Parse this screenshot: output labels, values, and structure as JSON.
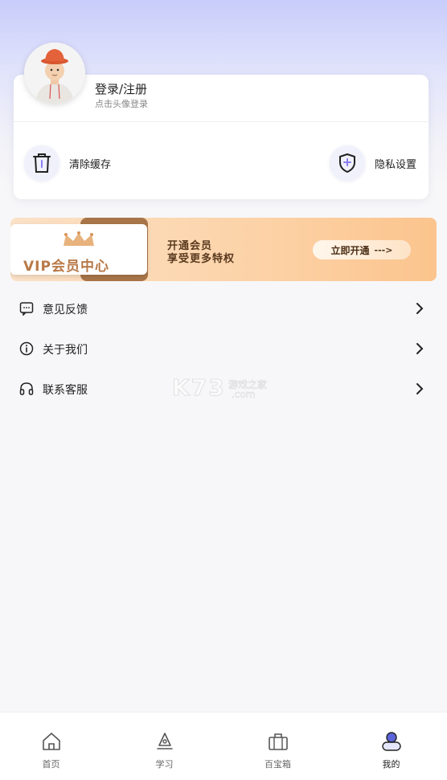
{
  "profile": {
    "title": "登录/注册",
    "subtitle": "点击头像登录"
  },
  "actions": {
    "clear_cache": "清除缓存",
    "privacy": "隐私设置"
  },
  "vip": {
    "title": "VIP会员中心",
    "line1": "开通会员",
    "line2": "享受更多特权",
    "button": "立即开通",
    "button_arrow": "--->"
  },
  "menu": {
    "items": [
      {
        "label": "意见反馈",
        "icon": "message-icon"
      },
      {
        "label": "关于我们",
        "icon": "info-icon"
      },
      {
        "label": "联系客服",
        "icon": "headset-icon"
      }
    ]
  },
  "watermark": {
    "main": "K73",
    "sub1": "游戏之家",
    "sub2": ".com"
  },
  "tabbar": {
    "items": [
      {
        "label": "首页",
        "icon": "home-icon"
      },
      {
        "label": "学习",
        "icon": "study-icon"
      },
      {
        "label": "百宝箱",
        "icon": "toolbox-icon"
      },
      {
        "label": "我的",
        "icon": "user-icon",
        "active": true
      }
    ]
  },
  "colors": {
    "accent": "#5a63d8",
    "vip_gold": "#b87947"
  }
}
